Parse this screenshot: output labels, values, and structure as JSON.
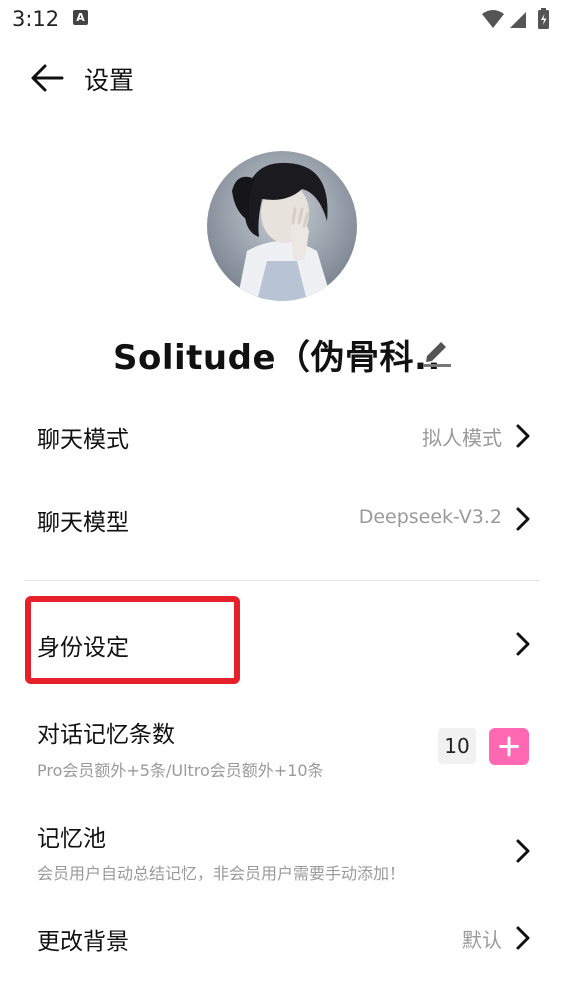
{
  "status_bar": {
    "time": "3:12",
    "notification_glyph": "A",
    "icons": [
      "wifi-icon",
      "cell-signal-icon",
      "battery-icon"
    ]
  },
  "header": {
    "title": "设置",
    "back_icon": "back-arrow-icon"
  },
  "profile": {
    "name": "Solitude（伪骨科..",
    "avatar": "avatar-image",
    "edit_icon": "edit-pencil-icon"
  },
  "settings": {
    "chat_mode": {
      "label": "聊天模式",
      "value": "拟人模式"
    },
    "chat_model": {
      "label": "聊天模型",
      "value": "Deepseek-V3.2"
    },
    "identity": {
      "label": "身份设定"
    },
    "memory_count": {
      "label": "对话记忆条数",
      "sub": "Pro会员额外+5条/Ultro会员额外+10条",
      "count": "10"
    },
    "memory_pool": {
      "label": "记忆池",
      "sub": "会员用户自动总结记忆，非会员用户需要手动添加！"
    },
    "background": {
      "label": "更改背景",
      "value": "默认"
    }
  },
  "colors": {
    "accent_pink": "#ff69b4",
    "highlight_red": "#e5202a",
    "muted_text": "#9a9a9a"
  }
}
